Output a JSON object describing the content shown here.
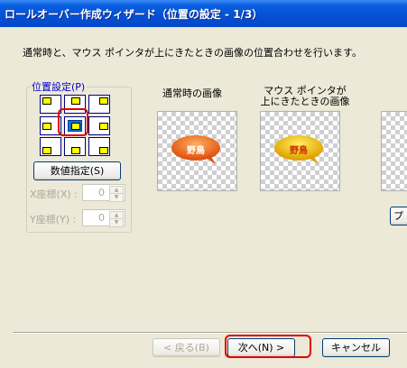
{
  "window": {
    "title": "ロールオーバー作成ウィザード（位置の設定 - 1/3）"
  },
  "description": "通常時と、マウス ポインタが上にきたときの画像の位置合わせを行います。",
  "position": {
    "group_label": "位置設定(P)",
    "selected_cell": "center",
    "numeric_button": "数値指定(S)",
    "x_label": "X座標(X) :",
    "x_value": "0",
    "y_label": "Y座標(Y) :",
    "y_value": "0"
  },
  "images": {
    "normal_label": "通常時の画像",
    "hover_label_line1": "マウス ポインタが",
    "hover_label_line2": "上にきたときの画像",
    "normal_text": "野鳥",
    "hover_text": "野鳥",
    "normal_color": "#f07020",
    "hover_color": "#f0b800"
  },
  "buttons": {
    "back": "< 戻る(B)",
    "next": "次へ(N) >",
    "cancel": "キャンセル",
    "partial": "プ"
  }
}
